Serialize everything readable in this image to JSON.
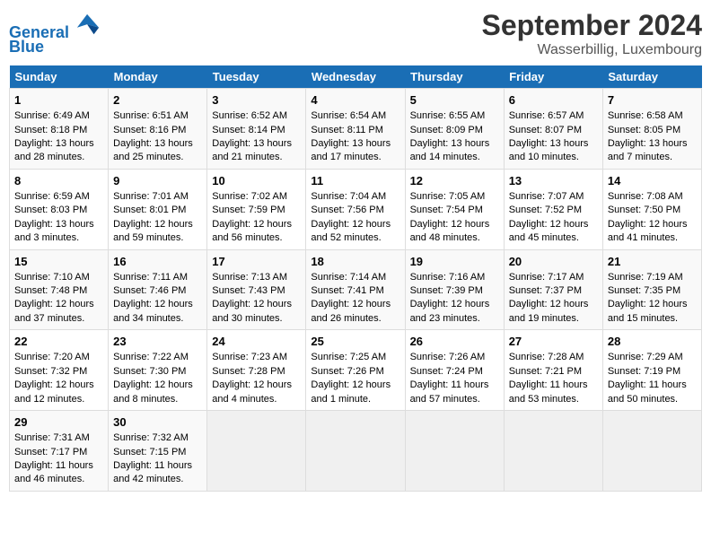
{
  "header": {
    "logo_line1": "General",
    "logo_line2": "Blue",
    "month": "September 2024",
    "location": "Wasserbillig, Luxembourg"
  },
  "days_of_week": [
    "Sunday",
    "Monday",
    "Tuesday",
    "Wednesday",
    "Thursday",
    "Friday",
    "Saturday"
  ],
  "weeks": [
    [
      {
        "day": "1",
        "sunrise": "Sunrise: 6:49 AM",
        "sunset": "Sunset: 8:18 PM",
        "daylight": "Daylight: 13 hours and 28 minutes."
      },
      {
        "day": "2",
        "sunrise": "Sunrise: 6:51 AM",
        "sunset": "Sunset: 8:16 PM",
        "daylight": "Daylight: 13 hours and 25 minutes."
      },
      {
        "day": "3",
        "sunrise": "Sunrise: 6:52 AM",
        "sunset": "Sunset: 8:14 PM",
        "daylight": "Daylight: 13 hours and 21 minutes."
      },
      {
        "day": "4",
        "sunrise": "Sunrise: 6:54 AM",
        "sunset": "Sunset: 8:11 PM",
        "daylight": "Daylight: 13 hours and 17 minutes."
      },
      {
        "day": "5",
        "sunrise": "Sunrise: 6:55 AM",
        "sunset": "Sunset: 8:09 PM",
        "daylight": "Daylight: 13 hours and 14 minutes."
      },
      {
        "day": "6",
        "sunrise": "Sunrise: 6:57 AM",
        "sunset": "Sunset: 8:07 PM",
        "daylight": "Daylight: 13 hours and 10 minutes."
      },
      {
        "day": "7",
        "sunrise": "Sunrise: 6:58 AM",
        "sunset": "Sunset: 8:05 PM",
        "daylight": "Daylight: 13 hours and 7 minutes."
      }
    ],
    [
      {
        "day": "8",
        "sunrise": "Sunrise: 6:59 AM",
        "sunset": "Sunset: 8:03 PM",
        "daylight": "Daylight: 13 hours and 3 minutes."
      },
      {
        "day": "9",
        "sunrise": "Sunrise: 7:01 AM",
        "sunset": "Sunset: 8:01 PM",
        "daylight": "Daylight: 12 hours and 59 minutes."
      },
      {
        "day": "10",
        "sunrise": "Sunrise: 7:02 AM",
        "sunset": "Sunset: 7:59 PM",
        "daylight": "Daylight: 12 hours and 56 minutes."
      },
      {
        "day": "11",
        "sunrise": "Sunrise: 7:04 AM",
        "sunset": "Sunset: 7:56 PM",
        "daylight": "Daylight: 12 hours and 52 minutes."
      },
      {
        "day": "12",
        "sunrise": "Sunrise: 7:05 AM",
        "sunset": "Sunset: 7:54 PM",
        "daylight": "Daylight: 12 hours and 48 minutes."
      },
      {
        "day": "13",
        "sunrise": "Sunrise: 7:07 AM",
        "sunset": "Sunset: 7:52 PM",
        "daylight": "Daylight: 12 hours and 45 minutes."
      },
      {
        "day": "14",
        "sunrise": "Sunrise: 7:08 AM",
        "sunset": "Sunset: 7:50 PM",
        "daylight": "Daylight: 12 hours and 41 minutes."
      }
    ],
    [
      {
        "day": "15",
        "sunrise": "Sunrise: 7:10 AM",
        "sunset": "Sunset: 7:48 PM",
        "daylight": "Daylight: 12 hours and 37 minutes."
      },
      {
        "day": "16",
        "sunrise": "Sunrise: 7:11 AM",
        "sunset": "Sunset: 7:46 PM",
        "daylight": "Daylight: 12 hours and 34 minutes."
      },
      {
        "day": "17",
        "sunrise": "Sunrise: 7:13 AM",
        "sunset": "Sunset: 7:43 PM",
        "daylight": "Daylight: 12 hours and 30 minutes."
      },
      {
        "day": "18",
        "sunrise": "Sunrise: 7:14 AM",
        "sunset": "Sunset: 7:41 PM",
        "daylight": "Daylight: 12 hours and 26 minutes."
      },
      {
        "day": "19",
        "sunrise": "Sunrise: 7:16 AM",
        "sunset": "Sunset: 7:39 PM",
        "daylight": "Daylight: 12 hours and 23 minutes."
      },
      {
        "day": "20",
        "sunrise": "Sunrise: 7:17 AM",
        "sunset": "Sunset: 7:37 PM",
        "daylight": "Daylight: 12 hours and 19 minutes."
      },
      {
        "day": "21",
        "sunrise": "Sunrise: 7:19 AM",
        "sunset": "Sunset: 7:35 PM",
        "daylight": "Daylight: 12 hours and 15 minutes."
      }
    ],
    [
      {
        "day": "22",
        "sunrise": "Sunrise: 7:20 AM",
        "sunset": "Sunset: 7:32 PM",
        "daylight": "Daylight: 12 hours and 12 minutes."
      },
      {
        "day": "23",
        "sunrise": "Sunrise: 7:22 AM",
        "sunset": "Sunset: 7:30 PM",
        "daylight": "Daylight: 12 hours and 8 minutes."
      },
      {
        "day": "24",
        "sunrise": "Sunrise: 7:23 AM",
        "sunset": "Sunset: 7:28 PM",
        "daylight": "Daylight: 12 hours and 4 minutes."
      },
      {
        "day": "25",
        "sunrise": "Sunrise: 7:25 AM",
        "sunset": "Sunset: 7:26 PM",
        "daylight": "Daylight: 12 hours and 1 minute."
      },
      {
        "day": "26",
        "sunrise": "Sunrise: 7:26 AM",
        "sunset": "Sunset: 7:24 PM",
        "daylight": "Daylight: 11 hours and 57 minutes."
      },
      {
        "day": "27",
        "sunrise": "Sunrise: 7:28 AM",
        "sunset": "Sunset: 7:21 PM",
        "daylight": "Daylight: 11 hours and 53 minutes."
      },
      {
        "day": "28",
        "sunrise": "Sunrise: 7:29 AM",
        "sunset": "Sunset: 7:19 PM",
        "daylight": "Daylight: 11 hours and 50 minutes."
      }
    ],
    [
      {
        "day": "29",
        "sunrise": "Sunrise: 7:31 AM",
        "sunset": "Sunset: 7:17 PM",
        "daylight": "Daylight: 11 hours and 46 minutes."
      },
      {
        "day": "30",
        "sunrise": "Sunrise: 7:32 AM",
        "sunset": "Sunset: 7:15 PM",
        "daylight": "Daylight: 11 hours and 42 minutes."
      },
      {
        "day": "",
        "sunrise": "",
        "sunset": "",
        "daylight": ""
      },
      {
        "day": "",
        "sunrise": "",
        "sunset": "",
        "daylight": ""
      },
      {
        "day": "",
        "sunrise": "",
        "sunset": "",
        "daylight": ""
      },
      {
        "day": "",
        "sunrise": "",
        "sunset": "",
        "daylight": ""
      },
      {
        "day": "",
        "sunrise": "",
        "sunset": "",
        "daylight": ""
      }
    ]
  ]
}
